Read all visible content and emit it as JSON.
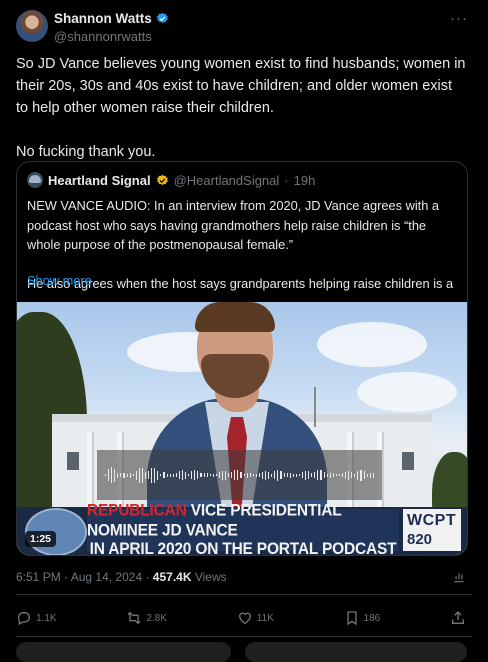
{
  "post": {
    "author_name": "Shannon Watts",
    "author_handle": "@shannonrwatts",
    "text": "So JD Vance believes young women exist to find husbands; women in their 20s, 30s and 40s exist to have children; and older women exist to help other women raise their children.\n\nNo fucking thank you.",
    "more_icon": "more-horizontal-icon",
    "verified_color": "#1d9bf0"
  },
  "quote": {
    "author_name": "Heartland Signal",
    "author_handle": "@HeartlandSignal",
    "separator": "·",
    "time": "19h",
    "text": "NEW VANCE AUDIO: In an interview from 2020, JD Vance agrees with a podcast host who says having grandmothers help raise children is “the whole purpose of the postmenopausal female.”\n\nHe also agrees when the host says grandparents helping raise children is a …",
    "show_more": "Show more",
    "verified_color": "#e8b416"
  },
  "media": {
    "duration": "1:25",
    "lower_third_prefix": "REPUBLICAN",
    "lower_third_line1_rest": " VICE PRESIDENTIAL NOMINEE JD VANCE",
    "lower_third_line2": "IN APRIL 2020 ON THE PORTAL PODCAST",
    "station_call": "WCPT",
    "station_freq": "820"
  },
  "meta": {
    "time": "6:51 PM",
    "sep": " · ",
    "date": "Aug 14, 2024",
    "views_count": "457.4K",
    "views_label": " Views"
  },
  "actions": {
    "replies": "1.1K",
    "reposts": "2.8K",
    "likes": "11K",
    "bookmarks": "186"
  },
  "colors": {
    "background": "#000000",
    "text": "#e7e9ea",
    "muted": "#71767b",
    "link": "#1d9bf0",
    "border": "#2f3336"
  }
}
